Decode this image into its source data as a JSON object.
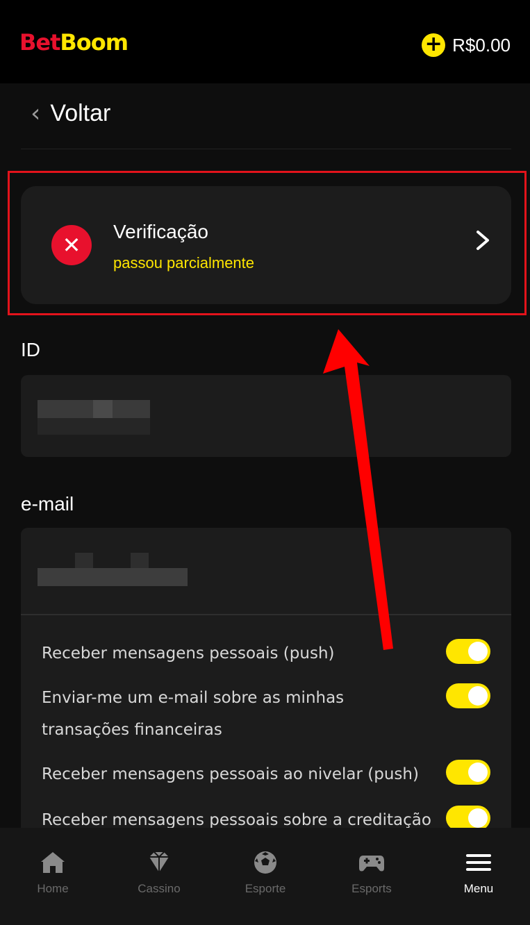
{
  "header": {
    "logo_part1": "Bet",
    "logo_part2": "Boom",
    "balance": "R$0.00",
    "add_funds_icon": "plus-icon"
  },
  "back": {
    "label": "Voltar"
  },
  "verification": {
    "title": "Verificação",
    "status": "passou parcialmente",
    "status_icon": "close-icon"
  },
  "fields": {
    "id_label": "ID",
    "email_label": "e-mail"
  },
  "preferences": [
    {
      "label": "Receber mensagens pessoais (push)",
      "enabled": true
    },
    {
      "label": "Enviar-me um e-mail sobre as minhas transações financeiras",
      "enabled": true
    },
    {
      "label": "Receber mensagens pessoais ao nivelar (push)",
      "enabled": true
    },
    {
      "label": "Receber mensagens pessoais sobre a creditação",
      "enabled": true
    }
  ],
  "nav": [
    {
      "label": "Home",
      "icon": "home-icon",
      "active": false
    },
    {
      "label": "Cassino",
      "icon": "diamond-icon",
      "active": false
    },
    {
      "label": "Esporte",
      "icon": "soccer-ball-icon",
      "active": false
    },
    {
      "label": "Esports",
      "icon": "gamepad-icon",
      "active": false
    },
    {
      "label": "Menu",
      "icon": "hamburger-menu-icon",
      "active": true
    }
  ],
  "colors": {
    "accent_yellow": "#ffe600",
    "brand_red": "#e8112d",
    "annotation_red": "#e3131b"
  }
}
